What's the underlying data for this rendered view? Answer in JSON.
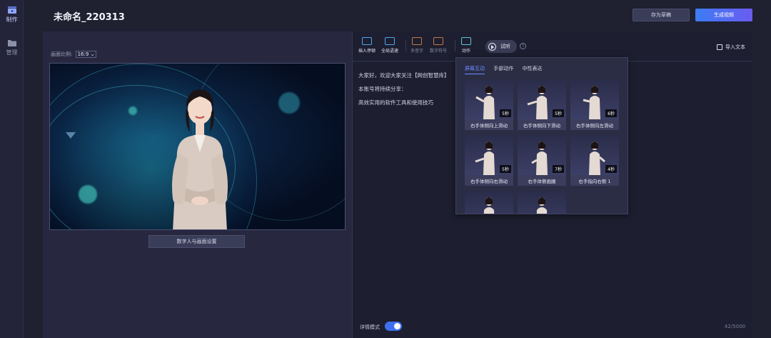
{
  "rail": {
    "items": [
      {
        "label": "制作",
        "icon": "clapperboard-icon",
        "active": true
      },
      {
        "label": "管理",
        "icon": "folder-icon",
        "active": false
      }
    ]
  },
  "header": {
    "title": "未命名_220313",
    "save_label": "存为草稿",
    "generate_label": "生成视频"
  },
  "canvas": {
    "ratio_label": "画面比例:",
    "ratio_value": "16:9",
    "settings_button": "数字人与画面设置"
  },
  "toolbar": {
    "tools": [
      {
        "label": "插入停顿",
        "icon": "pause-insert-icon"
      },
      {
        "label": "全局语速",
        "icon": "speed-icon"
      },
      {
        "label": "多音字",
        "icon": "polyphone-icon"
      },
      {
        "label": "数字符号",
        "icon": "number-symbol-icon"
      },
      {
        "label": "动作",
        "icon": "action-icon"
      }
    ],
    "listen_label": "试听",
    "import_label": "导入文本"
  },
  "script": {
    "lines": [
      "大家好，欢迎大家关注【网创智慧库】",
      "本账号将持续分享：",
      "高效实用的软件工具和使用技巧"
    ]
  },
  "footer": {
    "mode_label": "详情模式",
    "mode_on": true,
    "char_count": "42/5000"
  },
  "actions_panel": {
    "tabs": [
      "屏幕互动",
      "手部动作",
      "中性表达"
    ],
    "active_tab": 0,
    "items": [
      {
        "label": "右手体侧向上滑动",
        "duration": "5秒"
      },
      {
        "label": "右手体侧向下滑动",
        "duration": "5秒"
      },
      {
        "label": "右手体侧向左滑动",
        "duration": "6秒"
      },
      {
        "label": "右手体侧向右滑动",
        "duration": "5秒"
      },
      {
        "label": "右手体侧画圈",
        "duration": "7秒"
      },
      {
        "label": "右手指向右侧 1",
        "duration": "4秒"
      },
      {
        "label": "",
        "duration": ""
      },
      {
        "label": "",
        "duration": ""
      }
    ]
  },
  "colors": {
    "accent": "#3e6ff0",
    "generate_gradient_start": "#3d7cf4",
    "generate_gradient_end": "#6a5cf0",
    "active_tab": "#6b8cff"
  }
}
